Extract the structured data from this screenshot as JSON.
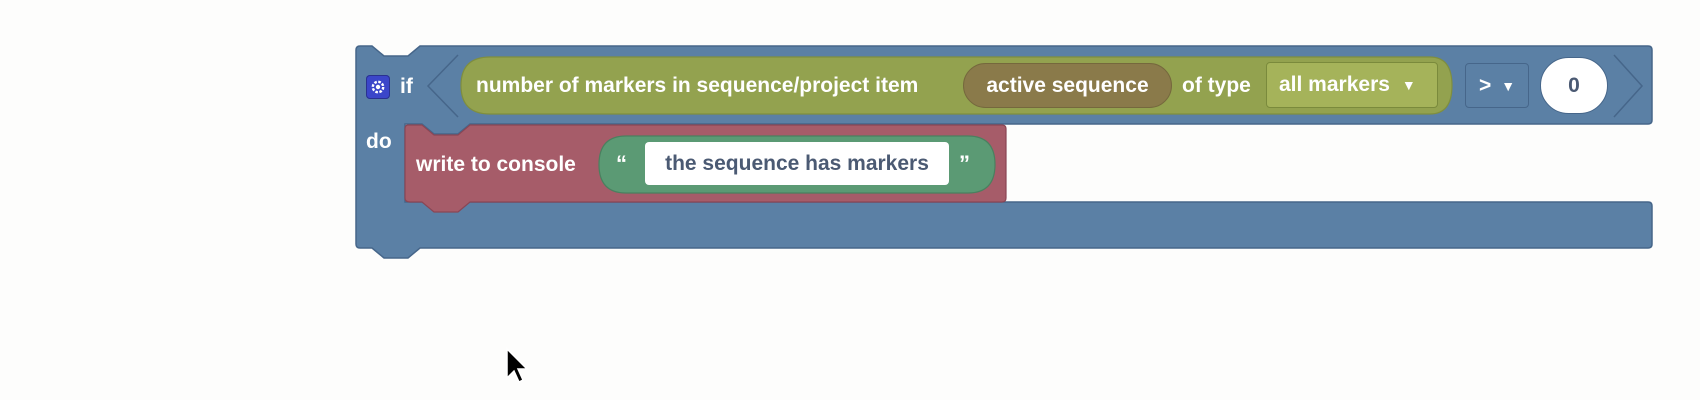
{
  "colors": {
    "background": "#fdfdfc",
    "control_block": "#5b80a5",
    "control_block_border": "#46668a",
    "number_block": "#93a24f",
    "number_block_inner": "#a5b35a",
    "dropdown_border": "#7a8a3c",
    "reporter": "#8a7a4a",
    "text_block": "#5b9a74",
    "console_block": "#a65c69",
    "console_block_border": "#8a4655"
  },
  "if_block": {
    "if_label": "if",
    "do_label": "do",
    "mutator_icon": "gear-icon"
  },
  "condition": {
    "markers_label": "number of markers in sequence/project item",
    "sequence_value": "active sequence",
    "of_type_label": "of type",
    "type_value": "all markers",
    "operator_value": ">",
    "compare_value": "0"
  },
  "action": {
    "label": "write to console",
    "open_quote": "“",
    "close_quote": "”",
    "text_value": "the sequence has markers"
  },
  "icons": {
    "dropdown": "caret-down-icon",
    "cursor": "mouse-pointer-icon"
  }
}
